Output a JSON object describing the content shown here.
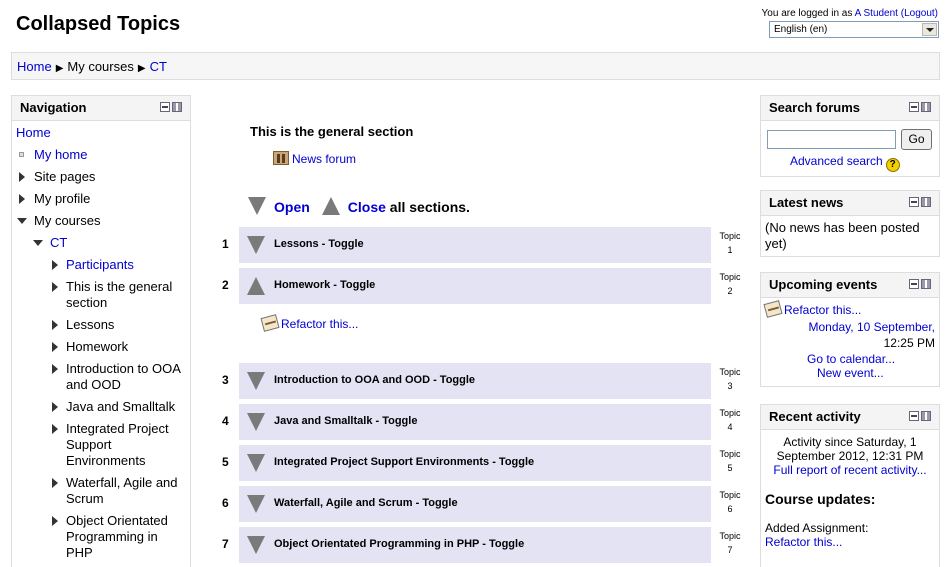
{
  "header": {
    "site_title": "Collapsed Topics",
    "login_prefix": "You are logged in as ",
    "user_name": "A Student",
    "logout_label": "(Logout)",
    "language_selected": "English (en)"
  },
  "breadcrumb": {
    "items": [
      "Home",
      "My courses",
      "CT"
    ],
    "separator": "▶"
  },
  "navigation": {
    "title": "Navigation",
    "home": "Home",
    "my_home": "My home",
    "site_pages": "Site pages",
    "my_profile": "My profile",
    "my_courses": "My courses",
    "course": "CT",
    "course_items": [
      "Participants",
      "This is the general section",
      "Lessons",
      "Homework",
      "Introduction to OOA and OOD",
      "Java and Smalltalk",
      "Integrated Project Support Environments",
      "Waterfall, Agile and Scrum",
      "Object Orientated Programming in PHP"
    ]
  },
  "main": {
    "general_title": "This is the general section",
    "news_forum": "News forum",
    "open_label": "Open",
    "close_label": "Close",
    "all_sections": "all sections.",
    "topic_word": "Topic",
    "sections": [
      {
        "num": "1",
        "label": "Lessons - Toggle",
        "topic_num": "1",
        "state": "closed"
      },
      {
        "num": "2",
        "label": "Homework - Toggle",
        "topic_num": "2",
        "state": "open"
      },
      {
        "num": "3",
        "label": "Introduction to OOA and OOD - Toggle",
        "topic_num": "3",
        "state": "closed"
      },
      {
        "num": "4",
        "label": "Java and Smalltalk - Toggle",
        "topic_num": "4",
        "state": "closed"
      },
      {
        "num": "5",
        "label": "Integrated Project Support Environments - Toggle",
        "topic_num": "5",
        "state": "closed"
      },
      {
        "num": "6",
        "label": "Waterfall, Agile and Scrum - Toggle",
        "topic_num": "6",
        "state": "closed"
      },
      {
        "num": "7",
        "label": "Object Orientated Programming in PHP - Toggle",
        "topic_num": "7",
        "state": "closed"
      }
    ],
    "refactor_link": "Refactor this..."
  },
  "search_forums": {
    "title": "Search forums",
    "input_value": "",
    "go_label": "Go",
    "advanced_label": "Advanced search",
    "help_glyph": "?"
  },
  "latest_news": {
    "title": "Latest news",
    "text": "(No news has been posted yet)"
  },
  "upcoming_events": {
    "title": "Upcoming events",
    "event_title": "Refactor this...",
    "event_date": "Monday, 10 September,",
    "event_time": "12:25 PM",
    "go_calendar": "Go to calendar...",
    "new_event": "New event..."
  },
  "recent_activity": {
    "title": "Recent activity",
    "since": "Activity since Saturday, 1 September 2012, 12:31 PM",
    "full_report": "Full report of recent activity...",
    "course_updates": "Course updates:",
    "added_assignment": "Added Assignment:",
    "assignment_link": "Refactor this..."
  },
  "colors": {
    "link": "#0000d0",
    "section_bar": "#e3e3f4",
    "toggle_triangle": "#7a7a7a",
    "block_header": "#f4f4f4"
  },
  "icons": [
    "forum-icon",
    "assignment-icon",
    "help-icon",
    "block-hide-icon",
    "block-dock-icon"
  ]
}
